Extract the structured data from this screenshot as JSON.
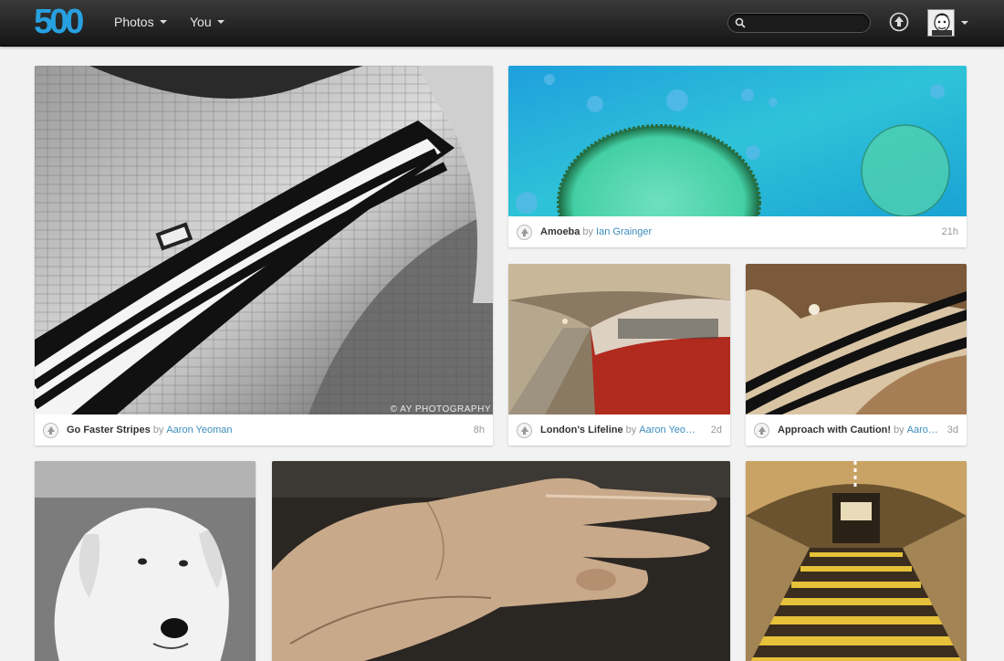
{
  "brand": {
    "logo_text": "500"
  },
  "nav": {
    "photos_label": "Photos",
    "you_label": "You"
  },
  "search": {
    "placeholder": "",
    "value": ""
  },
  "icons": {
    "search": "search-icon",
    "upload": "upload-icon",
    "vote": "upvote-icon",
    "caret": "caret-down-icon"
  },
  "colors": {
    "author_link": "#3b8dbd",
    "topbar": "#1e1e1e",
    "background": "#f2f2f2"
  },
  "photos": [
    {
      "title": "Go Faster Stripes",
      "by": "by",
      "author": "Aaron Yeoman",
      "age": "8h",
      "watermark": "© AY PHOTOGRAPHY"
    },
    {
      "title": "Amoeba",
      "by": "by",
      "author": "Ian Grainger",
      "age": "21h"
    },
    {
      "title": "London's Lifeline",
      "by": "by",
      "author": "Aaron Yeoman",
      "age": "2d"
    },
    {
      "title": "Approach with Caution!",
      "by": "by",
      "author": "Aaron Yeoman",
      "age": "3d"
    },
    {
      "title": "",
      "by": "",
      "author": "",
      "age": ""
    },
    {
      "title": "",
      "by": "",
      "author": "",
      "age": ""
    },
    {
      "title": "",
      "by": "",
      "author": "",
      "age": ""
    }
  ]
}
